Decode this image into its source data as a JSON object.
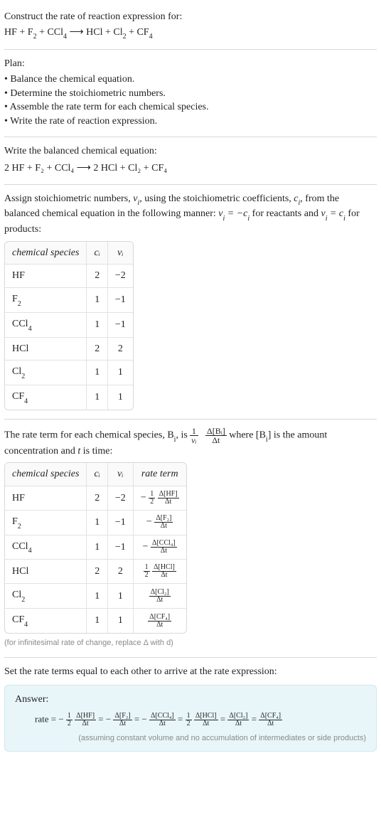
{
  "intro": {
    "line1": "Construct the rate of reaction expression for:",
    "eq_lhs": "HF + F",
    "eq_lhs_2": " + CCl",
    "eq_lhs_3": "  ⟶  HCl + Cl",
    "eq_lhs_4": " + CF"
  },
  "plan": {
    "title": "Plan:",
    "items": [
      "• Balance the chemical equation.",
      "• Determine the stoichiometric numbers.",
      "• Assemble the rate term for each chemical species.",
      "• Write the rate of reaction expression."
    ]
  },
  "balanced": {
    "title": "Write the balanced chemical equation:",
    "eq": "2 HF + F₂ + CCl₄  ⟶  2 HCl + Cl₂ + CF₄"
  },
  "stoich": {
    "p1a": "Assign stoichiometric numbers, ",
    "nu_i": "ν",
    "p1b": ", using the stoichiometric coefficients, ",
    "c_i": "c",
    "p1c": ", from the balanced chemical equation in the following manner: ",
    "rel1": "ν",
    "rel1b": " = −c",
    "p1d": " for reactants and ",
    "rel2": "ν",
    "rel2b": " = c",
    "p1e": " for products:",
    "headers": [
      "chemical species",
      "cᵢ",
      "νᵢ"
    ],
    "rows": [
      {
        "sp": "HF",
        "spSub": "",
        "c": "2",
        "nu": "−2"
      },
      {
        "sp": "F",
        "spSub": "2",
        "c": "1",
        "nu": "−1"
      },
      {
        "sp": "CCl",
        "spSub": "4",
        "c": "1",
        "nu": "−1"
      },
      {
        "sp": "HCl",
        "spSub": "",
        "c": "2",
        "nu": "2"
      },
      {
        "sp": "Cl",
        "spSub": "2",
        "c": "1",
        "nu": "1"
      },
      {
        "sp": "CF",
        "spSub": "4",
        "c": "1",
        "nu": "1"
      }
    ]
  },
  "rateterm": {
    "p_a": "The rate term for each chemical species, B",
    "p_b": ", is ",
    "frac1_num": "1",
    "frac1_den": "νᵢ",
    "frac2_num": "Δ[Bᵢ]",
    "frac2_den": "Δt",
    "p_c": " where [B",
    "p_d": "] is the amount concentration and ",
    "t": "t",
    "p_e": " is time:",
    "headers": [
      "chemical species",
      "cᵢ",
      "νᵢ",
      "rate term"
    ],
    "rows": [
      {
        "sp": "HF",
        "spSub": "",
        "c": "2",
        "nu": "−2",
        "sign": "−",
        "half": true,
        "num": "Δ[HF]",
        "den": "Δt"
      },
      {
        "sp": "F",
        "spSub": "2",
        "c": "1",
        "nu": "−1",
        "sign": "−",
        "half": false,
        "num": "Δ[F₂]",
        "den": "Δt"
      },
      {
        "sp": "CCl",
        "spSub": "4",
        "c": "1",
        "nu": "−1",
        "sign": "−",
        "half": false,
        "num": "Δ[CCl₄]",
        "den": "Δt"
      },
      {
        "sp": "HCl",
        "spSub": "",
        "c": "2",
        "nu": "2",
        "sign": "",
        "half": true,
        "num": "Δ[HCl]",
        "den": "Δt"
      },
      {
        "sp": "Cl",
        "spSub": "2",
        "c": "1",
        "nu": "1",
        "sign": "",
        "half": false,
        "num": "Δ[Cl₂]",
        "den": "Δt"
      },
      {
        "sp": "CF",
        "spSub": "4",
        "c": "1",
        "nu": "1",
        "sign": "",
        "half": false,
        "num": "Δ[CF₄]",
        "den": "Δt"
      }
    ],
    "note": "(for infinitesimal rate of change, replace Δ with d)"
  },
  "final": {
    "lead": "Set the rate terms equal to each other to arrive at the rate expression:",
    "answer_label": "Answer:",
    "rate_label": "rate = ",
    "terms": [
      {
        "sign": "−",
        "half": true,
        "num": "Δ[HF]",
        "den": "Δt"
      },
      {
        "sign": "−",
        "half": false,
        "num": "Δ[F₂]",
        "den": "Δt"
      },
      {
        "sign": "−",
        "half": false,
        "num": "Δ[CCl₄]",
        "den": "Δt"
      },
      {
        "sign": "",
        "half": true,
        "num": "Δ[HCl]",
        "den": "Δt"
      },
      {
        "sign": "",
        "half": false,
        "num": "Δ[Cl₂]",
        "den": "Δt"
      },
      {
        "sign": "",
        "half": false,
        "num": "Δ[CF₄]",
        "den": "Δt"
      }
    ],
    "note": "(assuming constant volume and no accumulation of intermediates or side products)"
  },
  "half": {
    "num": "1",
    "den": "2"
  }
}
